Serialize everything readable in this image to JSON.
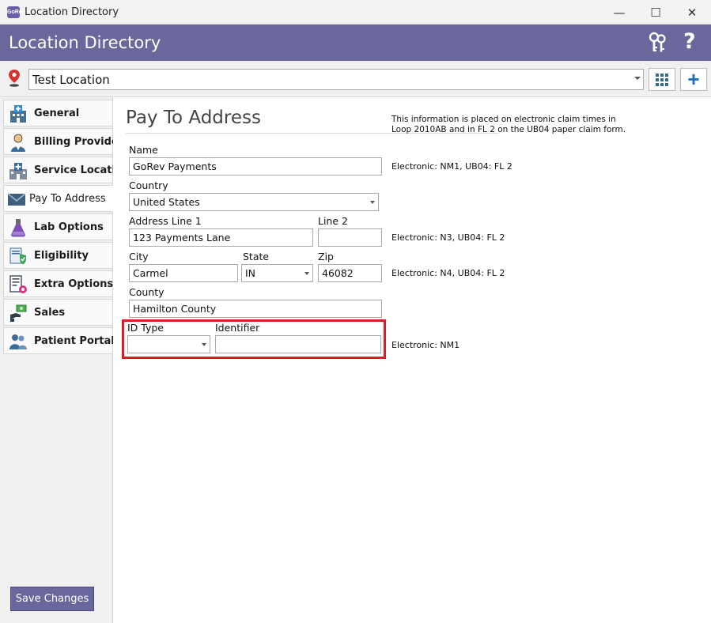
{
  "window": {
    "title": "Location Directory",
    "app_icon_text": "GoRev",
    "minimize_glyph": "—",
    "maximize_glyph": "☐",
    "close_glyph": "✕"
  },
  "header": {
    "title": "Location Directory",
    "help_glyph": "?",
    "icons": [
      "keys-icon",
      "help-icon"
    ]
  },
  "location": {
    "selected": "Test Location",
    "icons": [
      "map-pin-icon",
      "grid-icon",
      "plus-icon"
    ],
    "plus_glyph": "+"
  },
  "sidebar": {
    "items": [
      {
        "label": "General",
        "icon": "hospital-building-icon",
        "active": false
      },
      {
        "label": "Billing Provider",
        "icon": "doctor-icon",
        "active": false
      },
      {
        "label": "Service Location",
        "icon": "clinic-icon",
        "active": false
      },
      {
        "label": "Pay To Address",
        "icon": "envelope-icon",
        "active": true
      },
      {
        "label": "Lab Options",
        "icon": "flask-icon",
        "active": false
      },
      {
        "label": "Eligibility",
        "icon": "shield-check-icon",
        "active": false
      },
      {
        "label": "Extra Options",
        "icon": "settings-document-icon",
        "active": false
      },
      {
        "label": "Sales",
        "icon": "money-hand-icon",
        "active": false
      },
      {
        "label": "Patient Portal",
        "icon": "users-icon",
        "active": false
      }
    ],
    "save_label": "Save Changes"
  },
  "pane": {
    "title": "Pay To Address",
    "info": "This information is placed on electronic claim times in Loop 2010AB and in FL 2 on the UB04 paper claim form.",
    "fields": {
      "name_label": "Name",
      "name_value": "GoRev Payments",
      "country_label": "Country",
      "country_value": "United States",
      "address1_label": "Address Line 1",
      "address1_value": "123 Payments Lane",
      "line2_label": "Line 2",
      "line2_value": "",
      "city_label": "City",
      "city_value": "Carmel",
      "state_label": "State",
      "state_value": "IN",
      "zip_label": "Zip",
      "zip_value": "46082",
      "county_label": "County",
      "county_value": "Hamilton County",
      "id_type_label": "ID Type",
      "id_type_value": "",
      "identifier_label": "Identifier",
      "identifier_value": ""
    },
    "notes": {
      "name": "Electronic: NM1, UB04: FL 2",
      "address": "Electronic: N3, UB04: FL 2",
      "city": "Electronic: N4, UB04: FL 2",
      "id": "Electronic: NM1"
    },
    "highlight_color": "#e01b24"
  },
  "colors": {
    "header": "#6a679c",
    "accent_blue": "#1e73be",
    "highlight": "#e01b24"
  }
}
